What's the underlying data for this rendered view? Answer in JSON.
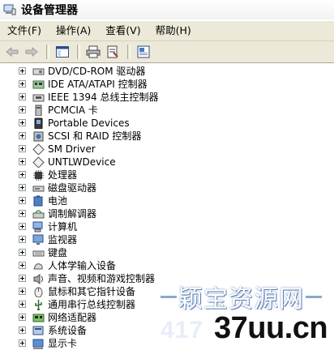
{
  "window": {
    "title": "设备管理器"
  },
  "menu": [
    {
      "label": "文件(F)"
    },
    {
      "label": "操作(A)"
    },
    {
      "label": "查看(V)"
    },
    {
      "label": "帮助(H)"
    }
  ],
  "toolbar": [
    {
      "icon": "back-arrow-icon"
    },
    {
      "icon": "forward-arrow-icon"
    },
    {
      "icon": "show-hide-tree-icon"
    },
    {
      "icon": "print-icon"
    },
    {
      "icon": "properties-icon"
    },
    {
      "icon": "help-icon"
    }
  ],
  "devices": [
    {
      "label": "DVD/CD-ROM 驱动器",
      "icon": "dvd-drive-icon"
    },
    {
      "label": "IDE ATA/ATAPI 控制器",
      "icon": "ide-controller-icon"
    },
    {
      "label": "IEEE 1394 总线主控制器",
      "icon": "ieee1394-icon"
    },
    {
      "label": "PCMCIA 卡",
      "icon": "pcmcia-icon"
    },
    {
      "label": "Portable Devices",
      "icon": "portable-device-icon"
    },
    {
      "label": "SCSI 和 RAID 控制器",
      "icon": "scsi-icon"
    },
    {
      "label": "SM Driver",
      "icon": "unknown-device-icon"
    },
    {
      "label": "UNTLWDevice",
      "icon": "unknown-device-icon"
    },
    {
      "label": "处理器",
      "icon": "processor-icon"
    },
    {
      "label": "磁盘驱动器",
      "icon": "disk-drive-icon"
    },
    {
      "label": "电池",
      "icon": "battery-icon"
    },
    {
      "label": "调制解调器",
      "icon": "modem-icon"
    },
    {
      "label": "计算机",
      "icon": "computer-icon"
    },
    {
      "label": "监视器",
      "icon": "monitor-icon"
    },
    {
      "label": "键盘",
      "icon": "keyboard-icon"
    },
    {
      "label": "人体学输入设备",
      "icon": "hid-icon"
    },
    {
      "label": "声音、视频和游戏控制器",
      "icon": "sound-icon"
    },
    {
      "label": "鼠标和其它指针设备",
      "icon": "mouse-icon"
    },
    {
      "label": "通用串行总线控制器",
      "icon": "usb-icon"
    },
    {
      "label": "网络适配器",
      "icon": "network-adapter-icon"
    },
    {
      "label": "系统设备",
      "icon": "system-device-icon"
    },
    {
      "label": "显示卡",
      "icon": "display-adapter-icon"
    }
  ],
  "watermark": {
    "site_name": "颖宝资源网",
    "number_text": "417",
    "domain": "37uu.cn"
  }
}
